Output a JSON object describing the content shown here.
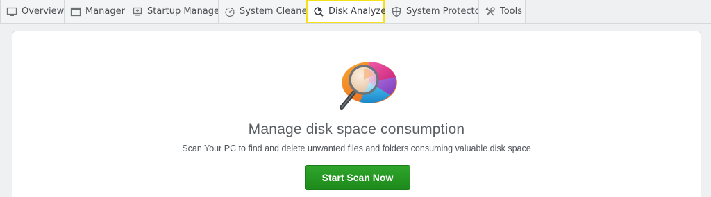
{
  "tabs": [
    {
      "label": "Overview",
      "icon": "monitor-icon"
    },
    {
      "label": "Manager",
      "icon": "window-icon"
    },
    {
      "label": "Startup Manager",
      "icon": "startup-icon"
    },
    {
      "label": "System Cleaner",
      "icon": "gauge-icon"
    },
    {
      "label": "Disk Analyzer",
      "icon": "disk-analyzer-icon",
      "active": true
    },
    {
      "label": "System Protector",
      "icon": "shield-icon"
    },
    {
      "label": "Tools",
      "icon": "tools-icon"
    }
  ],
  "main": {
    "hero_icon": "disk-chart-magnifier-icon",
    "headline": "Manage disk space consumption",
    "subline": "Scan Your PC to find and delete unwanted files and folders consuming valuable disk space",
    "scan_button_label": "Start Scan Now"
  },
  "colors": {
    "active_tab_border": "#f5e11a",
    "scan_button": "#23961f"
  }
}
